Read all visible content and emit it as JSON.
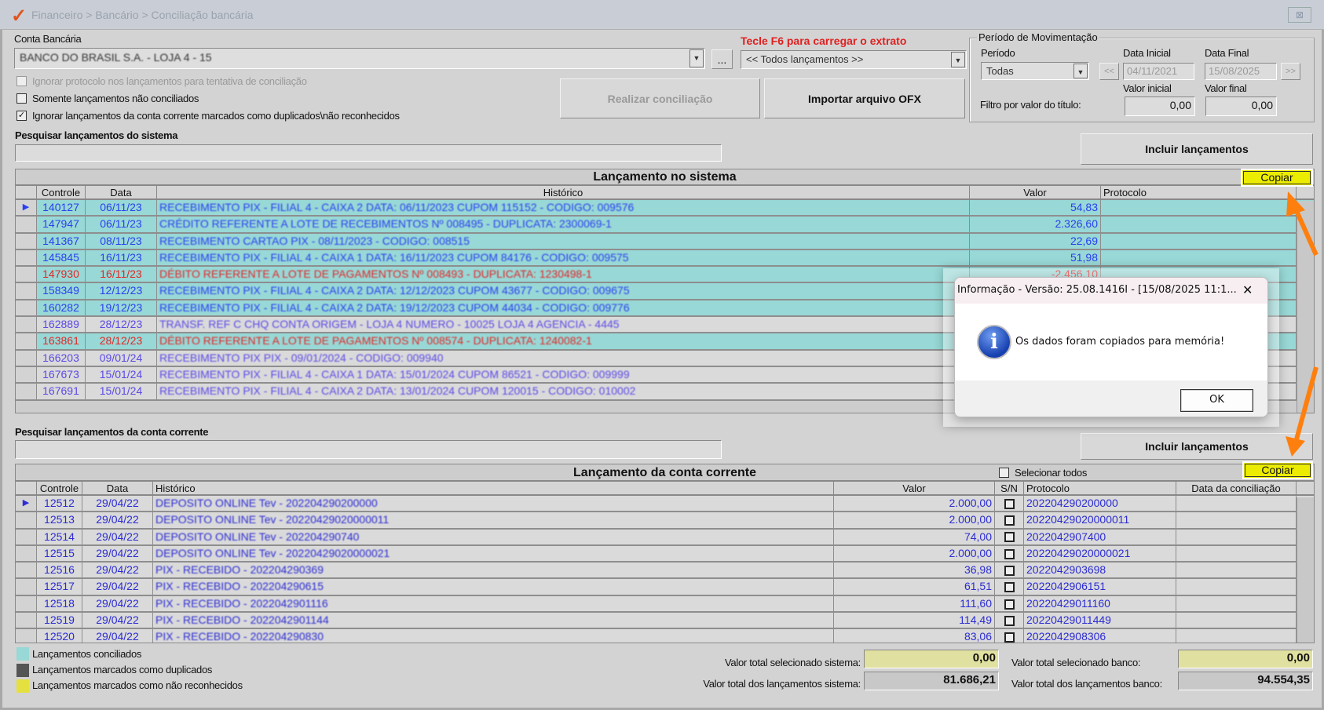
{
  "window": {
    "title": "Financeiro > Bancário > Conciliação bancária",
    "close": "⊠"
  },
  "account": {
    "label": "Conta Bancária",
    "value": "BANCO DO BRASIL S.A. - LOJA 4 - 15",
    "browse": "..."
  },
  "f6": {
    "hint": "Tecle F6 para carregar o extrato",
    "value": "<< Todos lançamentos >>"
  },
  "options": [
    {
      "label": "Ignorar protocolo nos lançamentos para tentativa de conciliação",
      "checked": false,
      "disabled": true
    },
    {
      "label": "Somente lançamentos não conciliados",
      "checked": false,
      "disabled": false
    },
    {
      "label": "Ignorar lançamentos da conta corrente marcados como duplicados\\não reconhecidos",
      "checked": true,
      "disabled": false
    }
  ],
  "buttons": {
    "realizar": "Realizar conciliação",
    "importar": "Importar arquivo OFX",
    "incluir": "Incluir lançamentos",
    "copiar": "Copiar"
  },
  "periodo": {
    "legend": "Período de Movimentação",
    "periodo_label": "Período",
    "periodo_value": "Todas",
    "data_inicial_label": "Data Inicial",
    "data_inicial": "04/11/2021",
    "data_final_label": "Data Final",
    "data_final": "15/08/2025",
    "prev": "<<",
    "next": ">>",
    "valor_inicial_label": "Valor inicial",
    "valor_final_label": "Valor final",
    "filtro_label": "Filtro por valor do título:",
    "valor_inicial": "0,00",
    "valor_final": "0,00"
  },
  "sistema": {
    "search_label": "Pesquisar lançamentos do sistema",
    "title": "Lançamento no sistema",
    "columns": [
      "Controle",
      "Data",
      "Histórico",
      "Valor",
      "Protocolo"
    ],
    "rows": [
      {
        "controle": "140127",
        "data": "06/11/23",
        "historico": "RECEBIMENTO PIX - FILIAL 4 - CAIXA 2 DATA: 06/11/2023 CUPOM 115152 - CODIGO: 009576",
        "valor": "54,83",
        "protocolo": "",
        "status": "cyan",
        "color": "blue"
      },
      {
        "controle": "147947",
        "data": "06/11/23",
        "historico": "CRÉDITO REFERENTE A LOTE DE RECEBIMENTOS Nº 008495 - DUPLICATA: 2300069-1",
        "valor": "2.326,60",
        "protocolo": "",
        "status": "cyan",
        "color": "blue"
      },
      {
        "controle": "141367",
        "data": "08/11/23",
        "historico": "RECEBIMENTO CARTAO PIX - 08/11/2023 - CODIGO: 008515",
        "valor": "22,69",
        "protocolo": "",
        "status": "cyan",
        "color": "blue"
      },
      {
        "controle": "145845",
        "data": "16/11/23",
        "historico": "RECEBIMENTO PIX - FILIAL 4 - CAIXA 1 DATA: 16/11/2023 CUPOM 84176 - CODIGO: 009575",
        "valor": "51,98",
        "protocolo": "",
        "status": "cyan",
        "color": "blue"
      },
      {
        "controle": "147930",
        "data": "16/11/23",
        "historico": "DÉBITO REFERENTE A LOTE DE PAGAMENTOS Nº 008493 - DUPLICATA: 1230498-1",
        "valor": "-2.456,10",
        "protocolo": "",
        "status": "cyan",
        "color": "red"
      },
      {
        "controle": "158349",
        "data": "12/12/23",
        "historico": "RECEBIMENTO PIX - FILIAL 4 - CAIXA 2 DATA: 12/12/2023 CUPOM 43677 - CODIGO: 009675",
        "valor": "",
        "protocolo": "",
        "status": "cyan",
        "color": "blue"
      },
      {
        "controle": "160282",
        "data": "19/12/23",
        "historico": "RECEBIMENTO PIX - FILIAL 4 - CAIXA 2 DATA: 19/12/2023 CUPOM 44034 - CODIGO: 009776",
        "valor": "",
        "protocolo": "",
        "status": "cyan",
        "color": "blue"
      },
      {
        "controle": "162889",
        "data": "28/12/23",
        "historico": "TRANSF. REF C CHQ CONTA ORIGEM - LOJA 4 NUMERO - 10025 LOJA 4 AGENCIA - 4445",
        "valor": "",
        "protocolo": "",
        "status": "gray",
        "color": "purple"
      },
      {
        "controle": "163861",
        "data": "28/12/23",
        "historico": "DÉBITO REFERENTE A LOTE DE PAGAMENTOS Nº 008574 - DUPLICATA: 1240082-1",
        "valor": "",
        "protocolo": "",
        "status": "cyan",
        "color": "red"
      },
      {
        "controle": "166203",
        "data": "09/01/24",
        "historico": "RECEBIMENTO PIX PIX - 09/01/2024 - CODIGO: 009940",
        "valor": "",
        "protocolo": "",
        "status": "gray",
        "color": "purple"
      },
      {
        "controle": "167673",
        "data": "15/01/24",
        "historico": "RECEBIMENTO PIX - FILIAL 4 - CAIXA 1 DATA: 15/01/2024 CUPOM 86521 - CODIGO: 009999",
        "valor": "",
        "protocolo": "",
        "status": "gray",
        "color": "purple"
      },
      {
        "controle": "167691",
        "data": "15/01/24",
        "historico": "RECEBIMENTO PIX - FILIAL 4 - CAIXA 2 DATA: 13/01/2024 CUPOM 120015 - CODIGO: 010002",
        "valor": "",
        "protocolo": "",
        "status": "gray",
        "color": "purple"
      }
    ]
  },
  "conta": {
    "search_label": "Pesquisar lançamentos da conta corrente",
    "title": "Lançamento da conta corrente",
    "select_all": "Selecionar todos",
    "columns": [
      "Controle",
      "Data",
      "Histórico",
      "Valor",
      "S/N",
      "Protocolo",
      "Data da conciliação"
    ],
    "rows": [
      {
        "controle": "12512",
        "data": "29/04/22",
        "historico": "DEPOSITO ONLINE Tev - 202204290200000",
        "valor": "2.000,00",
        "protocolo": "202204290200000",
        "conciliacao": ""
      },
      {
        "controle": "12513",
        "data": "29/04/22",
        "historico": "DEPOSITO ONLINE Tev - 20220429020000011",
        "valor": "2.000,00",
        "protocolo": "20220429020000011",
        "conciliacao": ""
      },
      {
        "controle": "12514",
        "data": "29/04/22",
        "historico": "DEPOSITO ONLINE Tev - 202204290740",
        "valor": "74,00",
        "protocolo": "202204290740​0",
        "conciliacao": ""
      },
      {
        "controle": "12515",
        "data": "29/04/22",
        "historico": "DEPOSITO ONLINE Tev - 20220429020000021",
        "valor": "2.000,00",
        "protocolo": "20220429020000021",
        "conciliacao": ""
      },
      {
        "controle": "12516",
        "data": "29/04/22",
        "historico": "PIX - RECEBIDO - 202204290369",
        "valor": "36,98",
        "protocolo": "202204290369​8",
        "conciliacao": ""
      },
      {
        "controle": "12517",
        "data": "29/04/22",
        "historico": "PIX - RECEBIDO - 202204290615",
        "valor": "61,51",
        "protocolo": "2022042906151",
        "conciliacao": ""
      },
      {
        "controle": "12518",
        "data": "29/04/22",
        "historico": "PIX - RECEBIDO - 2022042901116",
        "valor": "111,60",
        "protocolo": "20220429011160",
        "conciliacao": ""
      },
      {
        "controle": "12519",
        "data": "29/04/22",
        "historico": "PIX - RECEBIDO - 2022042901144",
        "valor": "114,49",
        "protocolo": "20220429011449",
        "conciliacao": ""
      },
      {
        "controle": "12520",
        "data": "29/04/22",
        "historico": "PIX - RECEBIDO - 202204290830",
        "valor": "83,06",
        "protocolo": "2022042908306",
        "conciliacao": ""
      }
    ]
  },
  "legend": [
    {
      "label": "Lançamentos conciliados",
      "color": "#98d8d6"
    },
    {
      "label": "Lançamentos marcados como duplicados",
      "color": "#555555"
    },
    {
      "label": "Lançamentos marcados como não reconhecidos",
      "color": "#e4e040"
    }
  ],
  "totals": {
    "sel_sistema_label": "Valor total selecionado sistema:",
    "sel_sistema": "0,00",
    "tot_sistema_label": "Valor total dos lançamentos sistema:",
    "tot_sistema": "81.686,21",
    "sel_banco_label": "Valor total selecionado banco:",
    "sel_banco": "0,00",
    "tot_banco_label": "Valor total dos lançamentos banco:",
    "tot_banco": "94.554,35"
  },
  "dialog": {
    "title": "Informação - Versão: 25.08.1416I - [15/08/2025 11:1...",
    "message": "Os dados foram copiados para memória!",
    "ok": "OK",
    "close": "✕"
  },
  "colors": {
    "annotation_arrow": "#ff7f0e",
    "copy_button": "#ecec00"
  }
}
